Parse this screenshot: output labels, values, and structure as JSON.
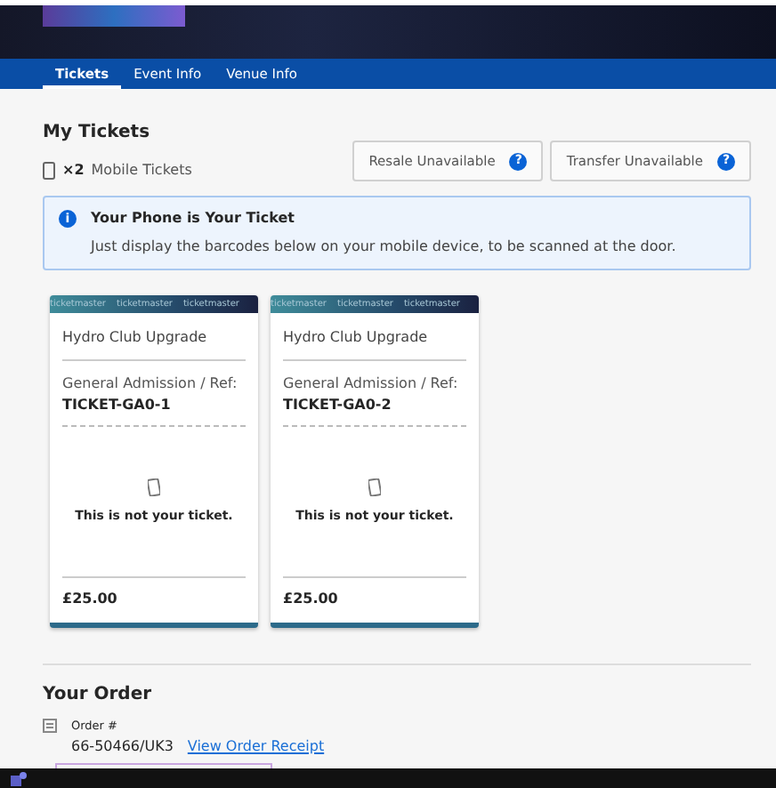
{
  "tabs": [
    {
      "label": "Tickets",
      "selected": true
    },
    {
      "label": "Event Info",
      "selected": false
    },
    {
      "label": "Venue Info",
      "selected": false
    }
  ],
  "my_tickets": {
    "title": "My Tickets",
    "count": "×2",
    "count_label": "Mobile Tickets",
    "buttons": [
      {
        "label": "Resale Unavailable",
        "help": "?",
        "disabled": true
      },
      {
        "label": "Transfer Unavailable",
        "help": "?",
        "disabled": true
      }
    ]
  },
  "info": {
    "icon": "i",
    "title": "Your Phone is Your Ticket",
    "text": "Just display the barcodes below on your mobile device, to be scanned at the door."
  },
  "tickets": [
    {
      "stripe_words": [
        "ticketmaster",
        "ticketmaster",
        "ticketmaster"
      ],
      "name": "Hydro Club Upgrade",
      "section": "General Admission / Ref:",
      "ref": "TICKET-GA0-1",
      "message": "This is not your ticket.",
      "price": "£25.00"
    },
    {
      "stripe_words": [
        "ticketmaster",
        "ticketmaster",
        "ticketmaster"
      ],
      "name": "Hydro Club Upgrade",
      "section": "General Admission / Ref:",
      "ref": "TICKET-GA0-2",
      "message": "This is not your ticket.",
      "price": "£25.00"
    }
  ],
  "order": {
    "title": "Your Order",
    "label": "Order #",
    "number": "66-50466/UK3",
    "link": "View Order Receipt"
  }
}
